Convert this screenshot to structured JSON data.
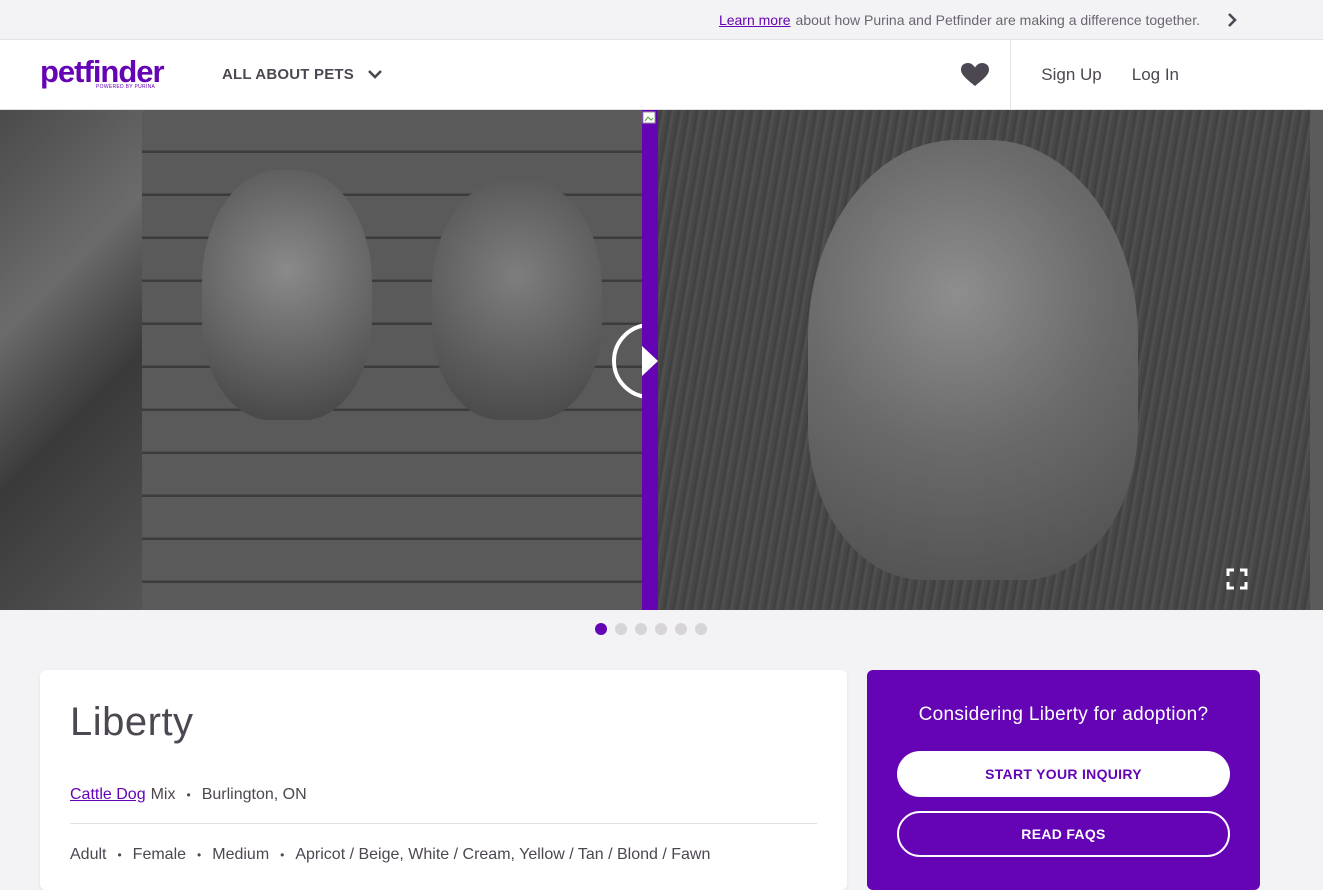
{
  "promo": {
    "link_text": "Learn more",
    "text": "about how Purina and Petfinder are making a difference together."
  },
  "header": {
    "logo_text": "petfinder",
    "logo_sub": "POWERED BY PURINA",
    "nav_label": "ALL ABOUT PETS",
    "sign_up": "Sign Up",
    "log_in": "Log In"
  },
  "carousel": {
    "photo_count": 6,
    "active_index": 0
  },
  "pet": {
    "name": "Liberty",
    "breed_link": "Cattle Dog",
    "breed_suffix": "Mix",
    "location": "Burlington, ON",
    "age": "Adult",
    "gender": "Female",
    "size": "Medium",
    "colors": "Apricot / Beige, White / Cream, Yellow / Tan / Blond / Fawn"
  },
  "adopt": {
    "title": "Considering Liberty for adoption?",
    "inquiry_button": "START YOUR INQUIRY",
    "faq_button": "READ FAQS"
  },
  "colors": {
    "brand": "#6504b5",
    "text": "#4d4751"
  }
}
